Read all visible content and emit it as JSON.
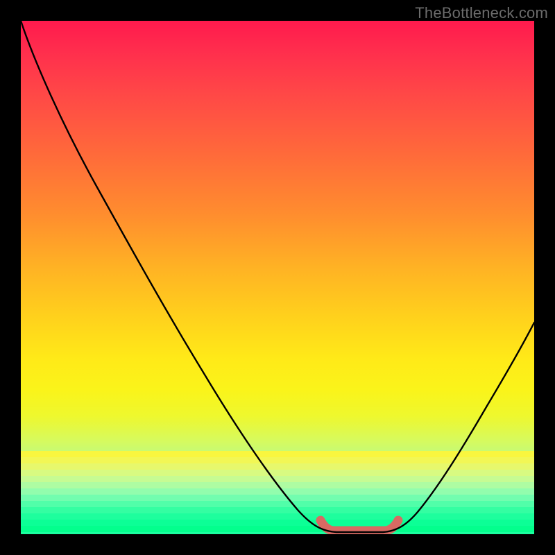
{
  "watermark": "TheBottleneck.com",
  "chart_data": {
    "type": "line",
    "title": "",
    "xlabel": "",
    "ylabel": "",
    "xlim": [
      0,
      100
    ],
    "ylim": [
      0,
      100
    ],
    "series": [
      {
        "name": "bottleneck-curve",
        "x": [
          0,
          5,
          10,
          15,
          20,
          25,
          30,
          35,
          40,
          45,
          50,
          55,
          58,
          60,
          63,
          67,
          70,
          72,
          75,
          80,
          85,
          90,
          95,
          100
        ],
        "y": [
          100,
          93,
          85,
          77,
          69,
          61,
          52,
          44,
          35,
          27,
          18,
          10,
          5,
          2,
          0.5,
          0.5,
          0.5,
          2,
          6,
          14,
          23,
          33,
          44,
          55
        ]
      }
    ],
    "optimal_range": {
      "x_start": 58,
      "x_end": 72
    },
    "gradient": {
      "top": "#ff1a4d",
      "mid": "#ffea18",
      "bottom": "#18fe9e"
    }
  }
}
